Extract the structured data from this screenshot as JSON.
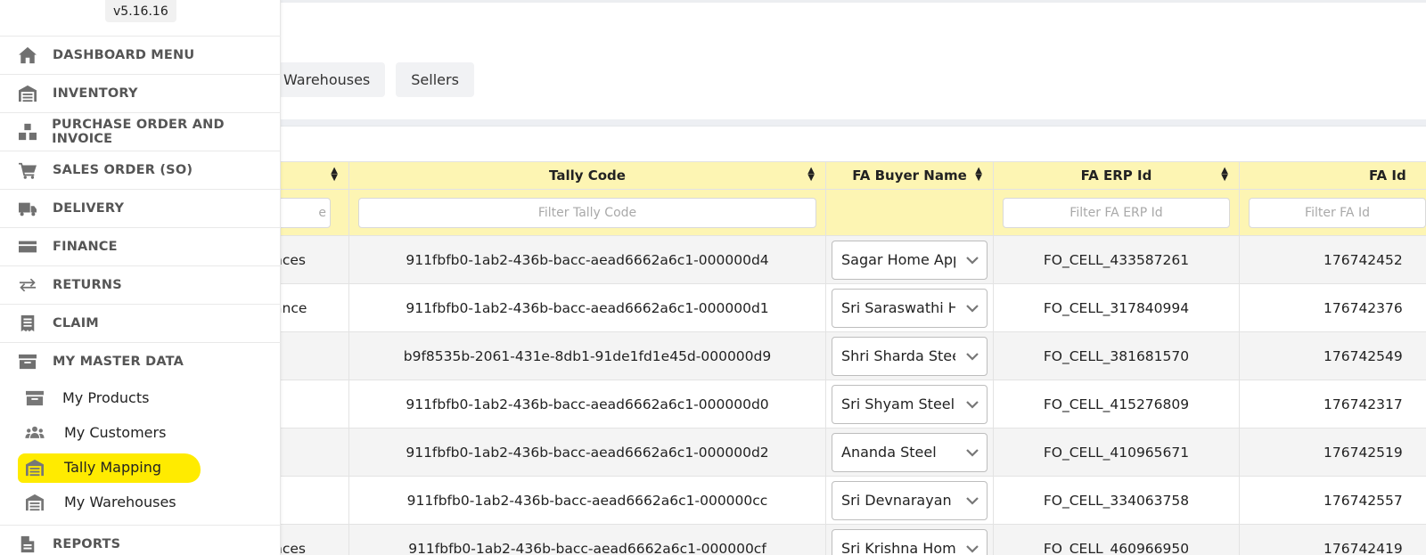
{
  "app": {
    "version": "v5.16.16"
  },
  "sidebar": {
    "items": [
      {
        "label": "DASHBOARD MENU",
        "icon": "home-icon"
      },
      {
        "label": "INVENTORY",
        "icon": "warehouse-icon"
      },
      {
        "label": "PURCHASE ORDER AND INVOICE",
        "icon": "boxes-icon"
      },
      {
        "label": "SALES ORDER (SO)",
        "icon": "cart-icon"
      },
      {
        "label": "DELIVERY",
        "icon": "truck-icon"
      },
      {
        "label": "FINANCE",
        "icon": "credit-card-icon"
      },
      {
        "label": "RETURNS",
        "icon": "exchange-icon"
      },
      {
        "label": "CLAIM",
        "icon": "receipt-icon"
      },
      {
        "label": "MY MASTER DATA",
        "icon": "archive-icon"
      }
    ],
    "master_data_sub": [
      {
        "label": "My Products",
        "icon": "archive-icon",
        "active": false
      },
      {
        "label": "My Customers",
        "icon": "users-icon",
        "active": false
      },
      {
        "label": "Tally Mapping",
        "icon": "warehouse-icon",
        "active": true
      },
      {
        "label": "My Warehouses",
        "icon": "warehouse-icon",
        "active": false
      }
    ],
    "reports": {
      "label": "REPORTS",
      "icon": "file-icon"
    }
  },
  "tabs": [
    "Warehouses",
    "Sellers"
  ],
  "table": {
    "columns": [
      {
        "label": "",
        "filter_placeholder": "e"
      },
      {
        "label": "Tally Code",
        "filter_placeholder": "Filter Tally Code"
      },
      {
        "label": "FA Buyer Name",
        "filter_placeholder": null
      },
      {
        "label": "FA ERP Id",
        "filter_placeholder": "Filter FA ERP Id"
      },
      {
        "label": "FA Id",
        "filter_placeholder": "Filter FA Id"
      }
    ],
    "rows": [
      {
        "name": "nces",
        "tally_code": "911fbfb0-1ab2-436b-bacc-aead6662a6c1-000000d4",
        "buyer": "Sagar Home Appliances",
        "erp_id": "FO_CELL_433587261",
        "fa_id": "176742452"
      },
      {
        "name": "ance",
        "tally_code": "911fbfb0-1ab2-436b-bacc-aead6662a6c1-000000d1",
        "buyer": "Sri Saraswathi Home",
        "erp_id": "FO_CELL_317840994",
        "fa_id": "176742376"
      },
      {
        "name": "",
        "tally_code": "b9f8535b-2061-431e-8db1-91de1fd1e45d-000000d9",
        "buyer": "Shri Sharda Steels",
        "erp_id": "FO_CELL_381681570",
        "fa_id": "176742549"
      },
      {
        "name": "",
        "tally_code": "911fbfb0-1ab2-436b-bacc-aead6662a6c1-000000d0",
        "buyer": "Sri Shyam Steel",
        "erp_id": "FO_CELL_415276809",
        "fa_id": "176742317"
      },
      {
        "name": "",
        "tally_code": "911fbfb0-1ab2-436b-bacc-aead6662a6c1-000000d2",
        "buyer": "Ananda Steel",
        "erp_id": "FO_CELL_410965671",
        "fa_id": "176742519"
      },
      {
        "name": "",
        "tally_code": "911fbfb0-1ab2-436b-bacc-aead6662a6c1-000000cc",
        "buyer": "Sri Devnarayan",
        "erp_id": "FO_CELL_334063758",
        "fa_id": "176742557"
      },
      {
        "name": "nces",
        "tally_code": "911fbfb0-1ab2-436b-bacc-aead6662a6c1-000000cf",
        "buyer": "Sri Krishna Home",
        "erp_id": "FO_CELL_460966950",
        "fa_id": "176742419"
      }
    ]
  },
  "colors": {
    "header_bg": "#fdf5b3",
    "highlight": "#ffeb00",
    "icon_gray": "#707070"
  }
}
